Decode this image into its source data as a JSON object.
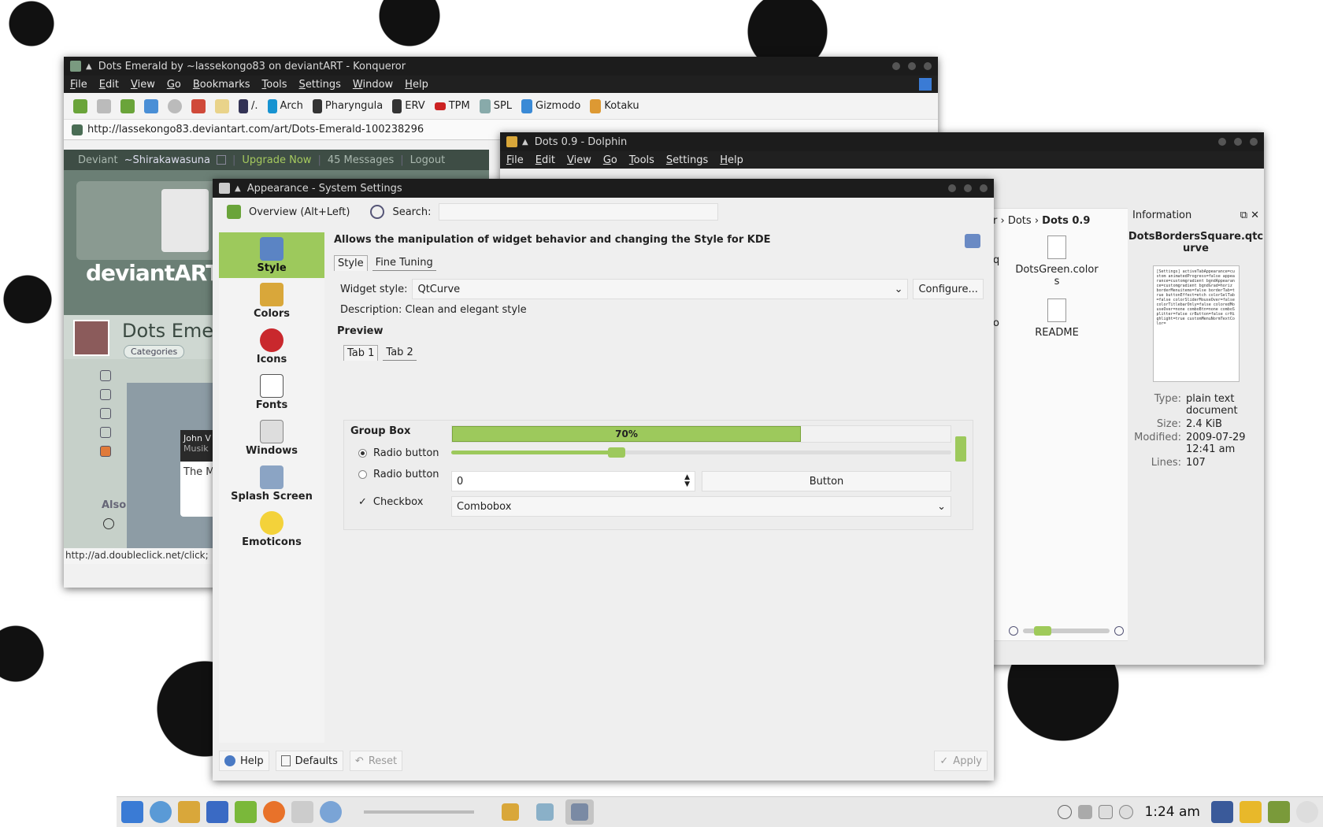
{
  "konqueror": {
    "title": "Dots Emerald by ~lassekongo83 on deviantART - Konqueror",
    "menu": [
      "File",
      "Edit",
      "View",
      "Go",
      "Bookmarks",
      "Tools",
      "Settings",
      "Window",
      "Help"
    ],
    "bookmarks": [
      "/.",
      "Arch",
      "Pharyngula",
      "ERV",
      "TPM",
      "SPL",
      "Gizmodo",
      "Kotaku"
    ],
    "url": "http://lassekongo83.deviantart.com/art/Dots-Emerald-100238296",
    "da_bar": {
      "deviant": "Deviant",
      "user": "~Shirakawasuna",
      "upgrade": "Upgrade Now",
      "messages": "45 Messages",
      "logout": "Logout"
    },
    "logo": "deviantART",
    "art_title": "Dots Emera",
    "categories": "Categories",
    "card_header": "John V",
    "card_sub": "Musik",
    "card_text": "The M",
    "also": "Also",
    "status": "http://ad.doubleclick.net/click;"
  },
  "dolphin": {
    "title": "Dots 0.9 - Dolphin",
    "menu": [
      "File",
      "Edit",
      "View",
      "Go",
      "Tools",
      "Settings",
      "Help"
    ],
    "breadcrumb": {
      "prefix": "r",
      "parent": "Dots",
      "current": "Dots 0.9"
    },
    "files": [
      {
        "name": "DotsGreen.colors"
      },
      {
        "name": "README"
      }
    ],
    "partial_labels": [
      "q",
      "o"
    ],
    "info": {
      "header": "Information",
      "filename": "DotsBordersSquare.qtcurve",
      "preview_text": "[Settings] activeTabAppearance=custom animatedProgress=false appearance=customgradient bgndAppearance=customgradient bgndGrad=horiz borderMenuitems=false borderTab=true buttonEffect=etch colorSelTab=false colorSliderMouseOver=false colorTitlebarOnly=false coloredMouseOver=none comboBtn=none comboSplitter=false crButton=false crHighlight=true customMenuNormTextColor=",
      "meta": [
        {
          "key": "Type:",
          "value": "plain text document"
        },
        {
          "key": "Size:",
          "value": "2.4 KiB"
        },
        {
          "key": "Modified:",
          "value": "2009-07-29 12:41 am"
        },
        {
          "key": "Lines:",
          "value": "107"
        }
      ]
    }
  },
  "settings": {
    "title": "Appearance - System Settings",
    "overview": "Overview (Alt+Left)",
    "search_label": "Search:",
    "sidebar": [
      {
        "label": "Style",
        "icon": "style-icon",
        "active": true
      },
      {
        "label": "Colors",
        "icon": "colors-icon"
      },
      {
        "label": "Icons",
        "icon": "icons-icon"
      },
      {
        "label": "Fonts",
        "icon": "fonts-icon"
      },
      {
        "label": "Windows",
        "icon": "windows-icon"
      },
      {
        "label": "Splash Screen",
        "icon": "splash-screen-icon"
      },
      {
        "label": "Emoticons",
        "icon": "emoticons-icon"
      }
    ],
    "description": "Allows the manipulation of widget behavior and changing the Style for KDE",
    "tabs": [
      "Style",
      "Fine Tuning"
    ],
    "widget_style_label": "Widget style:",
    "widget_style_value": "QtCurve",
    "configure": "Configure...",
    "style_description": "Description: Clean and elegant style",
    "preview_label": "Preview",
    "preview_tabs": [
      "Tab 1",
      "Tab 2"
    ],
    "group_box": "Group Box",
    "radio1": "Radio button",
    "radio2": "Radio button",
    "checkbox": "Checkbox",
    "progress": {
      "value": 70,
      "label": "70%"
    },
    "slider_value": 0.33,
    "spin_value": "0",
    "button": "Button",
    "combobox": "Combobox",
    "footer": {
      "help": "Help",
      "defaults": "Defaults",
      "reset": "Reset",
      "apply": "Apply"
    }
  },
  "taskbar": {
    "clock": "1:24 am"
  },
  "colors": {
    "accent": "#9dc95c",
    "titlebar": "#1c1c1c",
    "menubar": "#202020"
  }
}
